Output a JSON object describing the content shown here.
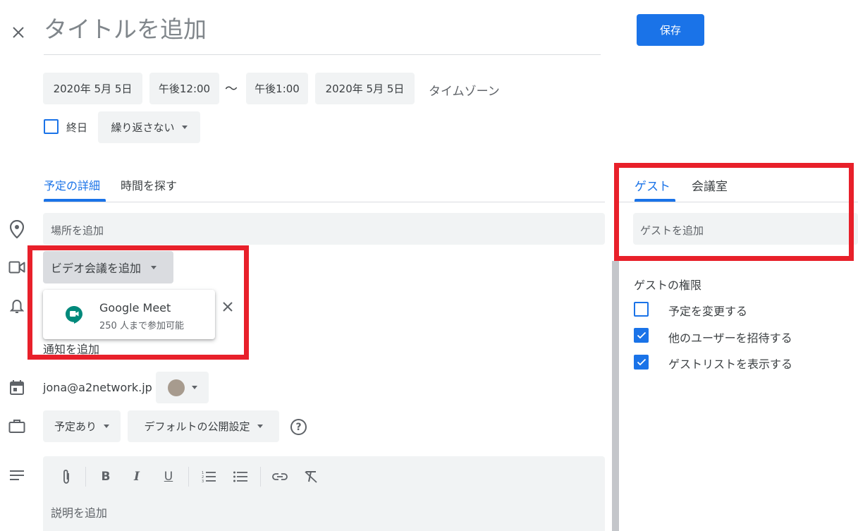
{
  "header": {
    "title_placeholder": "タイトルを追加",
    "save_label": "保存"
  },
  "datetime": {
    "start_date": "2020年 5月 5日",
    "start_time": "午後12:00",
    "separator": "〜",
    "end_time": "午後1:00",
    "end_date": "2020年 5月 5日",
    "timezone_label": "タイムゾーン",
    "all_day_label": "終日",
    "all_day_checked": false,
    "repeat_label": "繰り返さない"
  },
  "tabs": {
    "details": "予定の詳細",
    "find_time": "時間を探す",
    "active": "details"
  },
  "details": {
    "location_placeholder": "場所を追加",
    "video_button_label": "ビデオ会議を追加",
    "meet_option": {
      "title": "Google Meet",
      "subtitle": "250 人まで参加可能"
    },
    "notification_label": "通知を追加",
    "calendar_owner": "jona@a2network.jp",
    "calendar_color": "#a79b8e",
    "availability_label": "予定あり",
    "visibility_label": "デフォルトの公開設定",
    "description_placeholder": "説明を追加",
    "toolbar": [
      "attachment-icon",
      "bold-icon",
      "italic-icon",
      "underline-icon",
      "numbered-list-icon",
      "bulleted-list-icon",
      "link-icon",
      "clear-format-icon"
    ]
  },
  "guests": {
    "tab_guests": "ゲスト",
    "tab_rooms": "会議室",
    "active": "guests",
    "input_placeholder": "ゲストを追加",
    "permissions_title": "ゲストの権限",
    "permissions": [
      {
        "label": "予定を変更する",
        "checked": false
      },
      {
        "label": "他のユーザーを招待する",
        "checked": true
      },
      {
        "label": "ゲストリストを表示する",
        "checked": true
      }
    ]
  },
  "colors": {
    "accent": "#1a73e8",
    "highlight_red": "#e8202a",
    "meet_green": "#00897b"
  }
}
